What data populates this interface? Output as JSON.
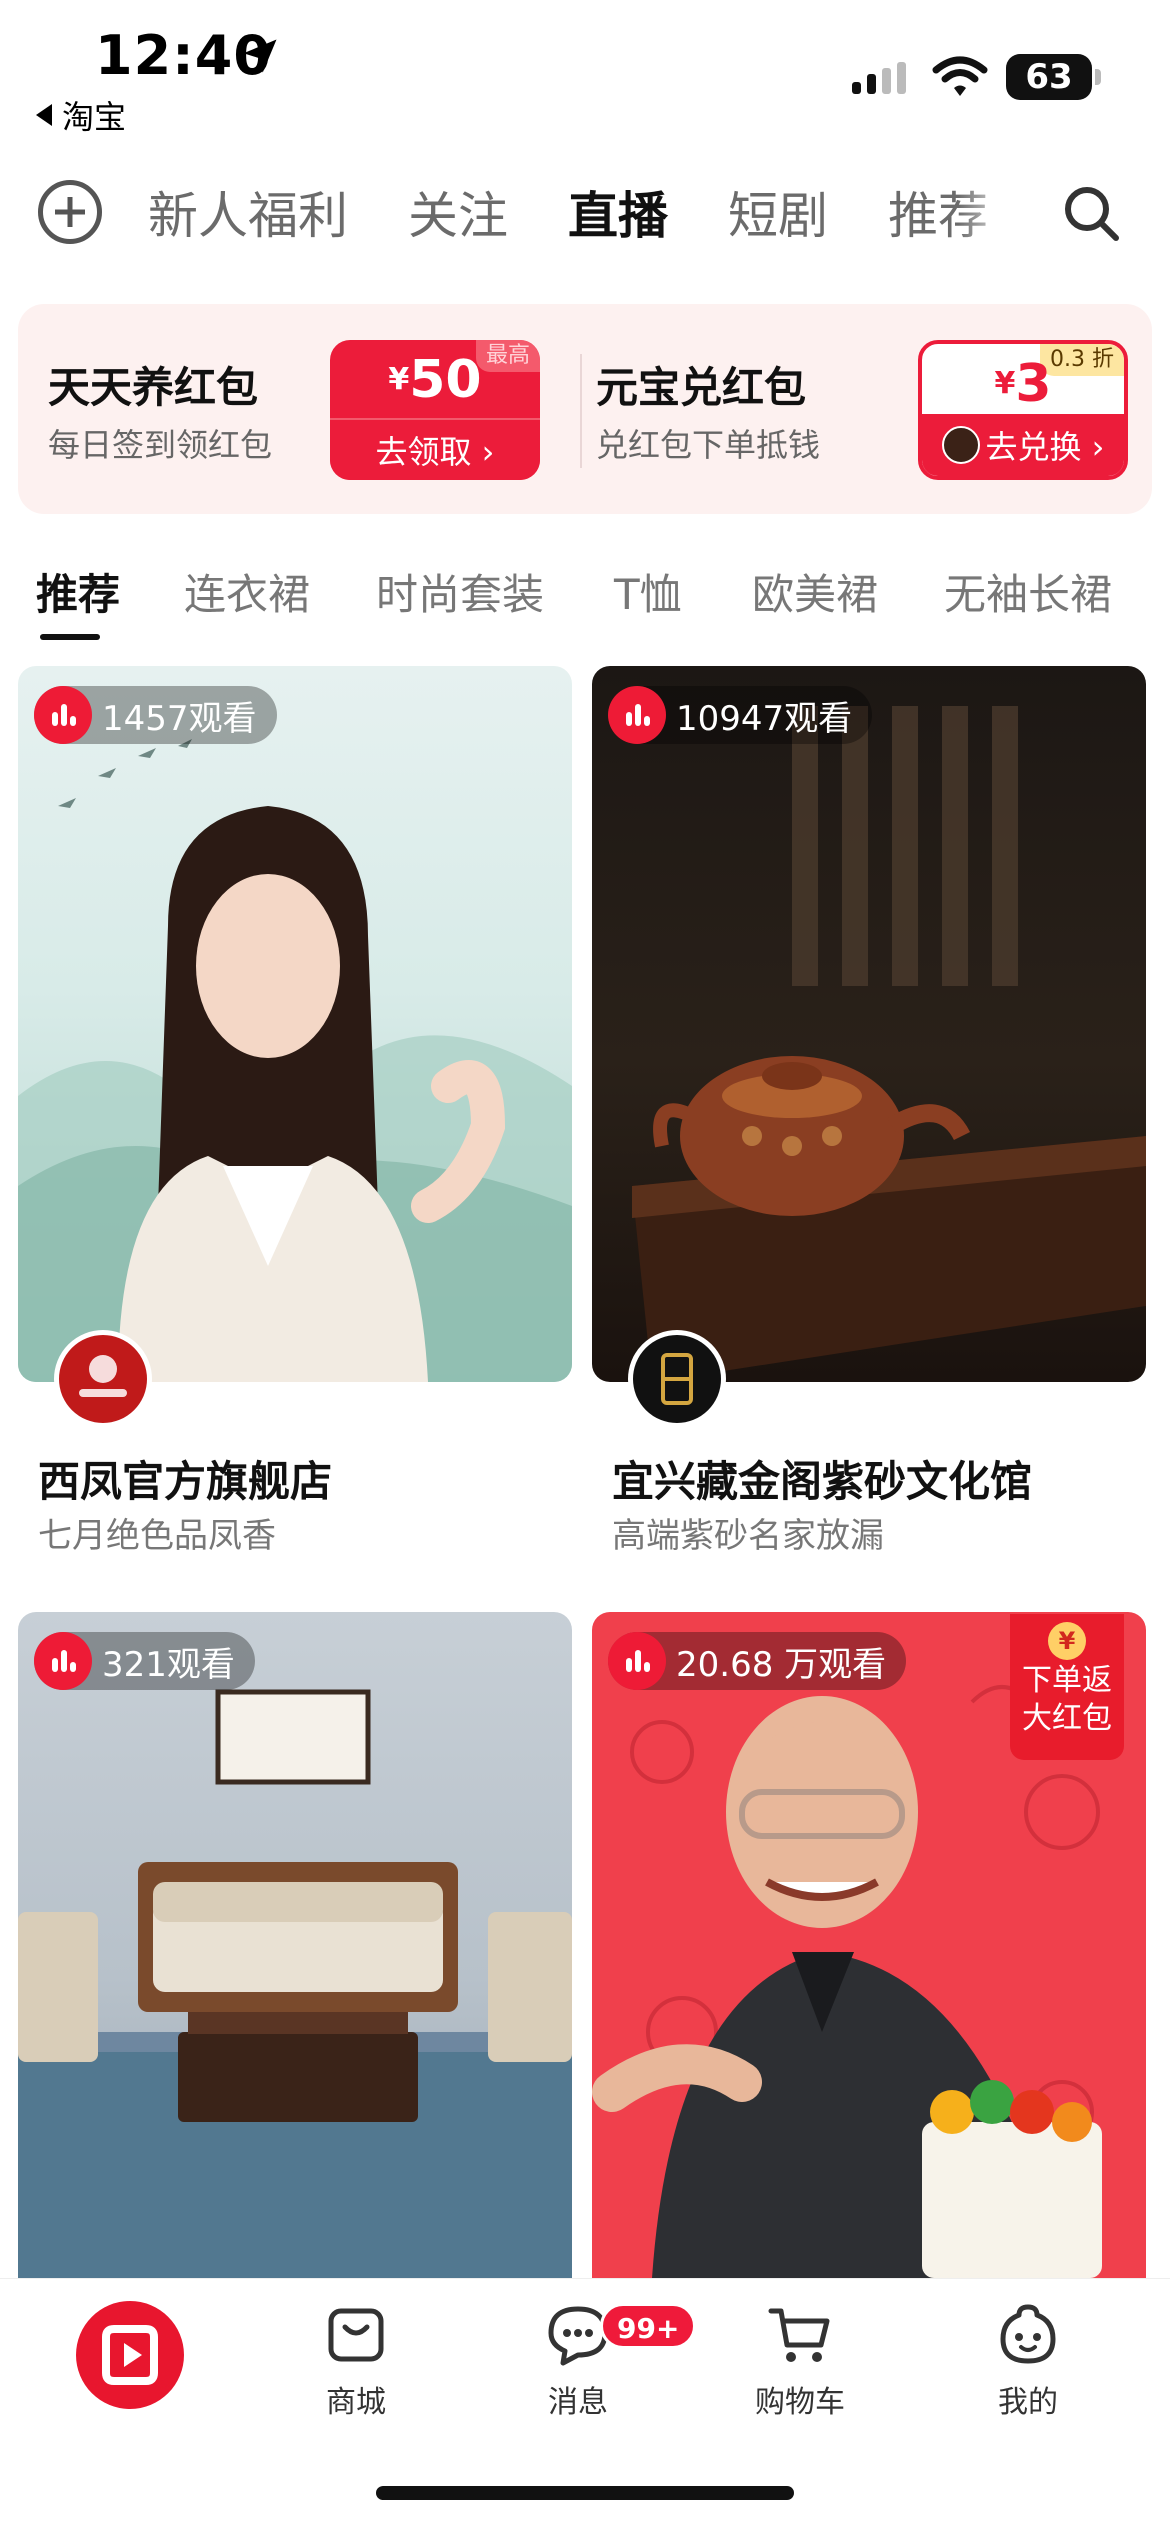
{
  "status_bar": {
    "time": "12:40",
    "back_app": "淘宝",
    "battery": "63"
  },
  "top_nav": {
    "tabs": [
      "新人福利",
      "关注",
      "直播",
      "短剧",
      "推荐"
    ],
    "active_tab": "直播"
  },
  "promo": {
    "left": {
      "title": "天天养红包",
      "subtitle": "每日签到领红包",
      "currency": "¥",
      "amount": "50",
      "tag": "最高",
      "action": "去领取 ›"
    },
    "right": {
      "title": "元宝兑红包",
      "subtitle": "兑红包下单抵钱",
      "currency": "¥",
      "amount": "3",
      "tag": "0.3 折",
      "action": "去兑换 ›"
    }
  },
  "categories": {
    "tabs": [
      "推荐",
      "连衣裙",
      "时尚套装",
      "T恤",
      "欧美裙",
      "无袖长裙"
    ],
    "active": "推荐"
  },
  "feed": [
    {
      "viewers": "1457观看",
      "title": "西凤官方旗舰店",
      "subtitle": "七月绝色品凤香"
    },
    {
      "viewers": "10947观看",
      "title": "宜兴藏金阁紫砂文化馆",
      "subtitle": "高端紫砂名家放漏"
    },
    {
      "viewers": "321观看"
    },
    {
      "viewers": "20.68 万观看",
      "badge_line1": "下单返",
      "badge_line2": "大红包",
      "badge_coin": "¥"
    }
  ],
  "tab_bar": {
    "items": [
      "商城",
      "消息",
      "购物车",
      "我的"
    ],
    "message_badge": "99+"
  },
  "colors": {
    "brand_red": "#ec1c3a",
    "promo_bg": "#fdf1f0",
    "text_primary": "#111111",
    "text_secondary": "#777777"
  }
}
